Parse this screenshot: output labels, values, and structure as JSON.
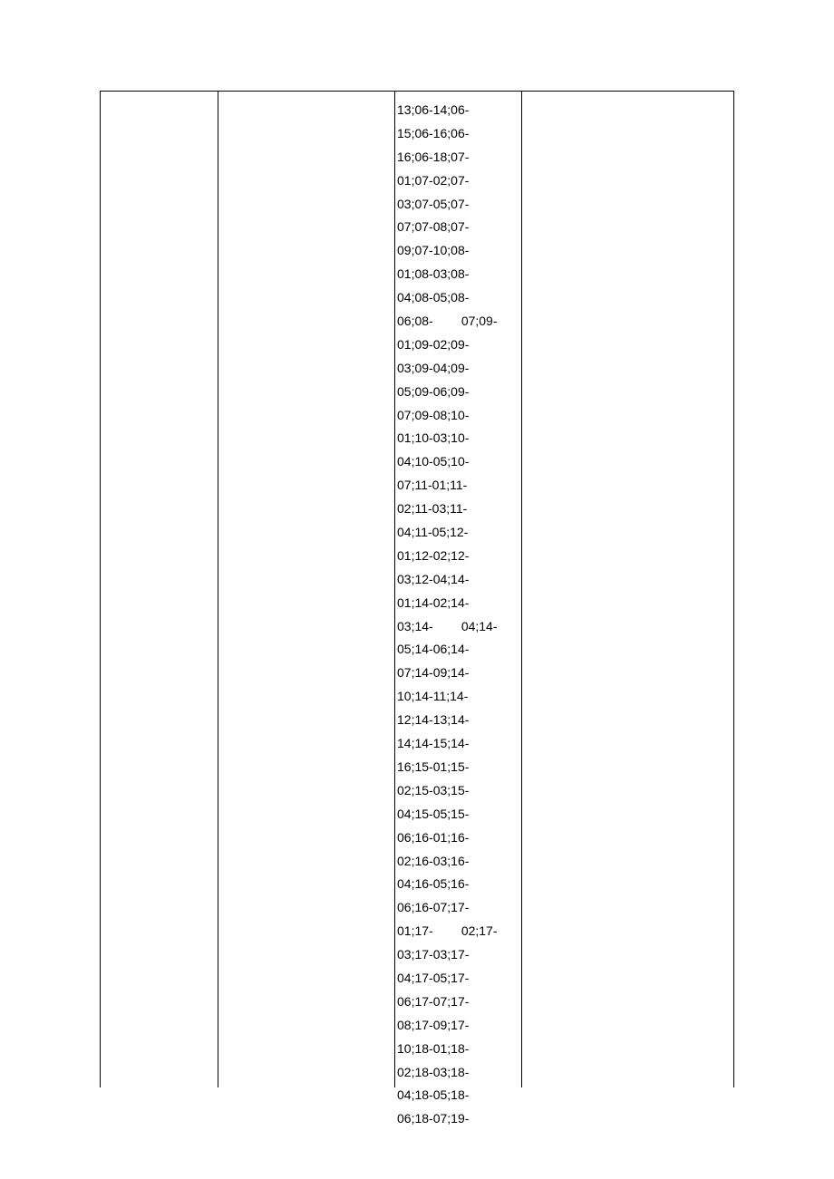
{
  "table": {
    "column3": {
      "lines": [
        "",
        "13;06-14;06-",
        "15;06-16;06-",
        "16;06-18;07-",
        "01;07-02;07-",
        "03;07-05;07-",
        "07;07-08;07-",
        "09;07-10;08-",
        "01;08-03;08-",
        "04;08-05;08-",
        "06;08-        07;09-",
        "01;09-02;09-",
        "03;09-04;09-",
        "05;09-06;09-",
        "07;09-08;10-",
        "01;10-03;10-",
        "04;10-05;10-",
        "07;11-01;11-",
        "02;11-03;11-",
        "04;11-05;12-",
        "01;12-02;12-",
        "03;12-04;14-",
        "01;14-02;14-",
        "03;14-        04;14-",
        "05;14-06;14-",
        "07;14-09;14-",
        "10;14-11;14-",
        "12;14-13;14-",
        "14;14-15;14-",
        "16;15-01;15-",
        "02;15-03;15-",
        "04;15-05;15-",
        "06;16-01;16-",
        "02;16-03;16-",
        "04;16-05;16-",
        "06;16-07;17-",
        "01;17-        02;17-",
        "03;17-03;17-",
        "04;17-05;17-",
        "06;17-07;17-",
        "08;17-09;17-",
        "10;18-01;18-",
        "02;18-03;18-",
        "04;18-05;18-",
        "06;18-07;19-"
      ]
    }
  }
}
